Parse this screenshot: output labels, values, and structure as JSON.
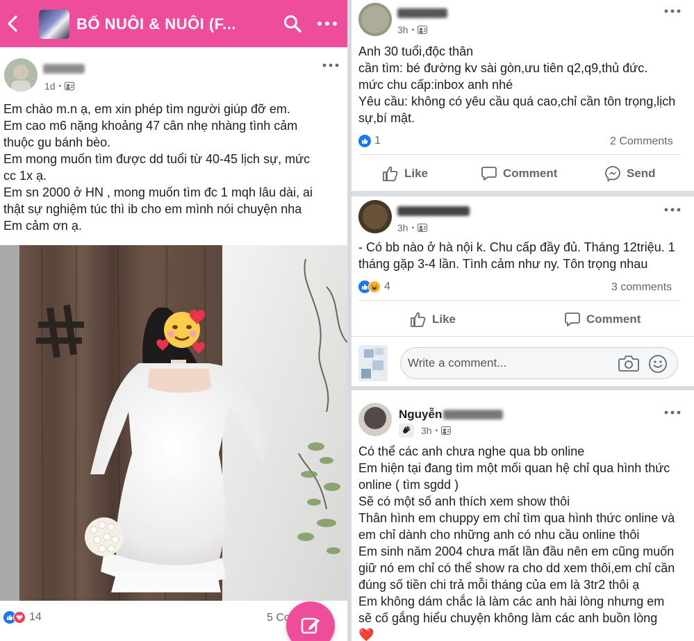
{
  "group": {
    "back_icon": "chevron-left-icon",
    "title": "BỐ NUÔI &   NUÔI (F...",
    "bar_color": "#ee4d9c"
  },
  "post1": {
    "time": "1d",
    "lines": [
      "Em chào m.n ạ, em xin phép tìm người giúp đỡ em.",
      "Em cao m6 nặng khoảng 47 cân nhẹ nhàng tình cảm",
      "thuộc gu bánh bèo.",
      "Em mong muốn tìm được dd tuổi từ 40-45 lịch sự, mức",
      "cc 1x ạ.",
      "Em sn 2000 ở HN , mong muốn tìm đc 1 mqh lâu dài, ai",
      "thật sự nghiệm túc thì ib cho em mình nói chuyện nha",
      "Em cảm ơn  ạ."
    ],
    "reaction_count": "14",
    "comments": "5 Comments"
  },
  "post2": {
    "time": "3h",
    "lines": [
      "Anh 30 tuổi,độc thân",
      "cần tìm: bé đường kv sài gòn,ưu tiên q2,q9,thủ đức.",
      "mức chu cấp:inbox anh nhé",
      "Yêu cầu: không có yêu cầu quá cao,chỉ cần tôn trọng,lịch",
      "sự,bí mật."
    ],
    "reaction_count": "1",
    "comments": "2 Comments",
    "actions": {
      "like": "Like",
      "comment": "Comment",
      "send": "Send"
    }
  },
  "post3": {
    "time": "3h",
    "lines": [
      "- Có bb nào ở hà nội k. Chu cấp đầy đủ. Tháng 12triệu. 1",
      "tháng gặp 3-4 lần. Tình cảm như ny. Tôn trọng nhau"
    ],
    "reaction_count": "4",
    "comments": "3 comments",
    "actions": {
      "like": "Like",
      "comment": "Comment"
    },
    "comment_placeholder": "Write a comment..."
  },
  "post4": {
    "author_first": "Nguyễn",
    "time": "3h",
    "lines": [
      "Có thể các anh chưa nghe qua bb online",
      "Em hiện tại đang tìm một mối quan hệ chỉ qua hình thức",
      "online ( tìm sgdd  )",
      "Sẽ có một số anh thích xem show thôi",
      "Thân hình em chuppy em chỉ tìm qua hình thức online và",
      "em chỉ dành cho những anh có nhu cầu online thôi",
      "Em sinh năm 2004 chưa mất lần đầu nên em cũng muốn",
      "giữ nó em chỉ có thể show ra cho dd xem thôi,em chỉ cần",
      "đúng số tiền chi trả mỗi tháng của em là 3tr2 thôi ạ",
      "Em không dám chắc là làm các anh hài lòng nhưng em",
      "sẽ cố gắng hiểu chuyện không làm các anh buồn lòng"
    ],
    "end_emoji": "❤️"
  },
  "colors": {
    "link_blue": "#1877f2",
    "love_red": "#f33e58",
    "haha_yellow": "#f7b125",
    "muted": "#65676b"
  }
}
